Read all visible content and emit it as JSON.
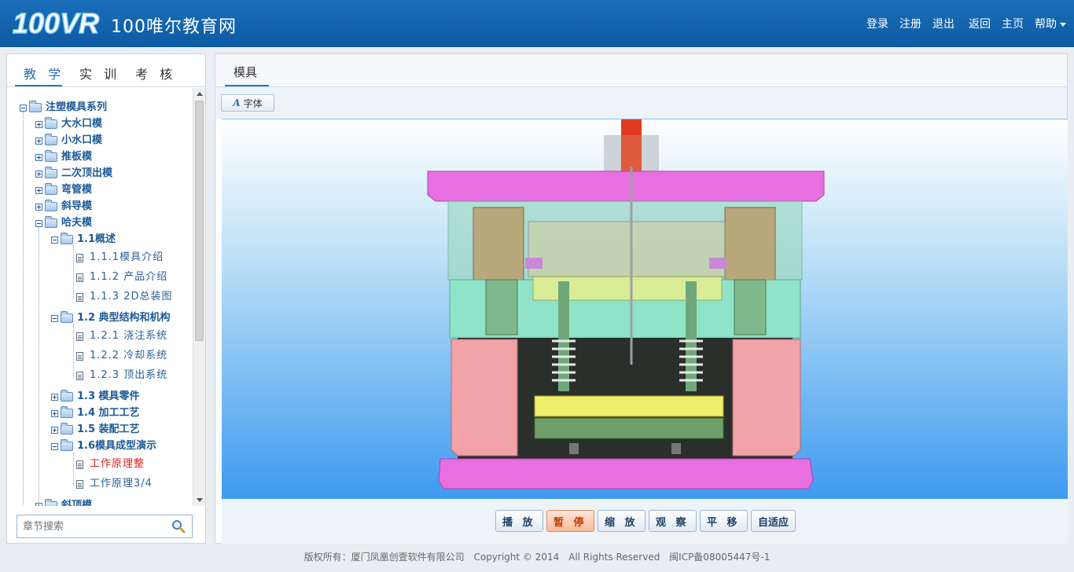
{
  "header": {
    "logo_text": "100VR",
    "site_title": "100唯尔教育网",
    "nav": [
      "登录",
      "注册",
      "退出",
      "返回",
      "主页"
    ],
    "help": "帮助"
  },
  "left_tabs": [
    "教 学",
    "实 训",
    "考 核"
  ],
  "tree": {
    "root": "注塑模具系列",
    "l1": [
      "大水口模",
      "小水口模",
      "推板模",
      "二次顶出模",
      "弯管模",
      "斜导模",
      "哈夫模"
    ],
    "s1": "1.1概述",
    "s1_items": [
      "1.1.1模具介绍",
      "1.1.2 产品介绍",
      "1.1.3 2D总装图"
    ],
    "s2": "1.2 典型结构和机构",
    "s2_items": [
      "1.2.1 浇注系统",
      "1.2.2 冷却系统",
      "1.2.3 顶出系统"
    ],
    "s3": "1.3 模具零件",
    "s4": "1.4 加工工艺",
    "s5": "1.5 装配工艺",
    "s6": "1.6模具成型演示",
    "s6_items": [
      "工作原理整",
      "工作原理3/4"
    ],
    "cut": "斜顶模"
  },
  "search": {
    "placeholder": "章节搜索"
  },
  "right_tab": "模具",
  "toolbar": {
    "font_label": "字体"
  },
  "controls": [
    "播 放",
    "暂 停",
    "缩 放",
    "观 察",
    "平 移",
    "自适应"
  ],
  "active_control": "暂 停",
  "footer": {
    "owner": "版权所有：厦门凤凰创壹软件有限公司",
    "copyright": "Copyright © 2014",
    "rights": "All Rights Reserved",
    "icp": "闽ICP备08005447号-1"
  },
  "colors": {
    "header": "#0d5aa3",
    "accent": "#2b79c2",
    "active_leaf": "#e0201a"
  }
}
